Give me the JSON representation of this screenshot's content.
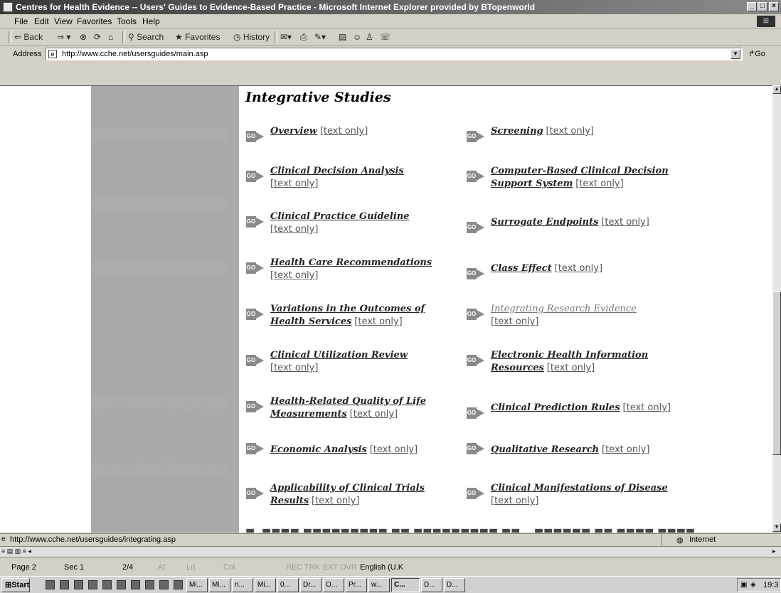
{
  "window": {
    "title": "Centres for Health Evidence -- Users' Guides to Evidence-Based Practice - Microsoft Internet Explorer provided by BTopenworld"
  },
  "menu": [
    "File",
    "Edit",
    "View",
    "Favorites",
    "Tools",
    "Help"
  ],
  "toolbar": {
    "back": "⇐ Back",
    "search": "Search",
    "favorites": "Favorites",
    "history": "History"
  },
  "address": {
    "label": "Address",
    "url": "http://www.cche.net/usersguides/main.asp",
    "go": "Go"
  },
  "page": {
    "heading": "Integrative Studies",
    "go_label": "GO",
    "text_only": "[text only]",
    "left_items": [
      {
        "title": "Overview"
      },
      {
        "title": "Clinical Decision Analysis"
      },
      {
        "title": "Clinical Practice Guideline"
      },
      {
        "title": "Health Care Recommendations"
      },
      {
        "title": "Variations in the Outcomes of Health Services"
      },
      {
        "title": "Clinical Utilization Review"
      },
      {
        "title": "Health-Related Quality of Life Measurements"
      },
      {
        "title": "Economic Analysis"
      },
      {
        "title": "Applicability of Clinical Trials Results"
      }
    ],
    "right_items": [
      {
        "title": "Screening"
      },
      {
        "title": "Computer-Based Clinical Decision Support System"
      },
      {
        "title": "Surrogate Endpoints"
      },
      {
        "title": "Class Effect"
      },
      {
        "title": "Integrating Research Evidence"
      },
      {
        "title": "Electronic Health Information Resources"
      },
      {
        "title": "Clinical Prediction Rules"
      },
      {
        "title": "Qualitative Research"
      },
      {
        "title": "Clinical Manifestations of Disease"
      }
    ]
  },
  "status": {
    "url": "http://www.cche.net/usersguides/integrating.asp",
    "zone": "Internet"
  },
  "word_status": {
    "page": "Page 2",
    "sec": "Sec 1",
    "pos": "2/4",
    "at": "At",
    "ln": "Ln",
    "col": "Col",
    "rec": "REC",
    "trk": "TRK",
    "ext": "EXT",
    "ovr": "OVR",
    "lang": "English (U.K"
  },
  "taskbar": {
    "start": "Start",
    "tasks": [
      "Mi...",
      "Mi...",
      "n...",
      "Mi...",
      "0...",
      "Dr...",
      "O...",
      "Pr...",
      "w...",
      "C...",
      "D...",
      "D..."
    ],
    "clock": "19:3"
  }
}
